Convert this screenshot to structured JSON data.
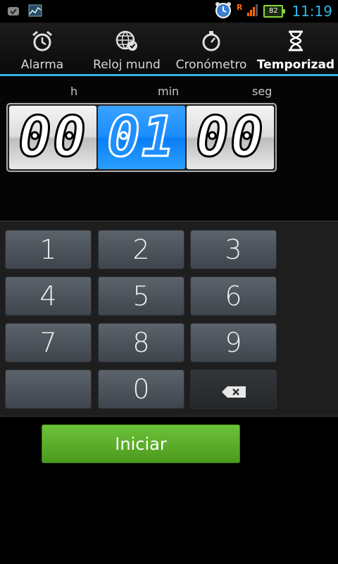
{
  "status_bar": {
    "time": "11:19",
    "battery_level": "82",
    "roaming_indicator": "R",
    "notification_icons": [
      "download-icon",
      "chart-icon"
    ],
    "system_icons": [
      "alarm-clock-icon",
      "signal-icon",
      "battery-icon"
    ]
  },
  "tabs": [
    {
      "label": "Alarma",
      "icon": "alarm-clock-icon",
      "active": false
    },
    {
      "label": "Reloj mund",
      "icon": "world-clock-icon",
      "active": false
    },
    {
      "label": "Cronómetro",
      "icon": "stopwatch-icon",
      "active": false
    },
    {
      "label": "Temporizad",
      "icon": "hourglass-icon",
      "active": true
    }
  ],
  "timer": {
    "labels": {
      "hours": "h",
      "minutes": "min",
      "seconds": "seg"
    },
    "hours": "00",
    "minutes": "01",
    "seconds": "00",
    "active_field": "minutes"
  },
  "keypad": {
    "keys": [
      "1",
      "2",
      "3",
      "4",
      "5",
      "6",
      "7",
      "8",
      "9",
      "",
      "0",
      "backspace"
    ]
  },
  "start_button": {
    "label": "Iniciar"
  },
  "colors": {
    "accent": "#33b5e5",
    "active_digit_bg": "#1b8dff",
    "start_button": "#5cae2a",
    "battery": "#8bd53a"
  }
}
